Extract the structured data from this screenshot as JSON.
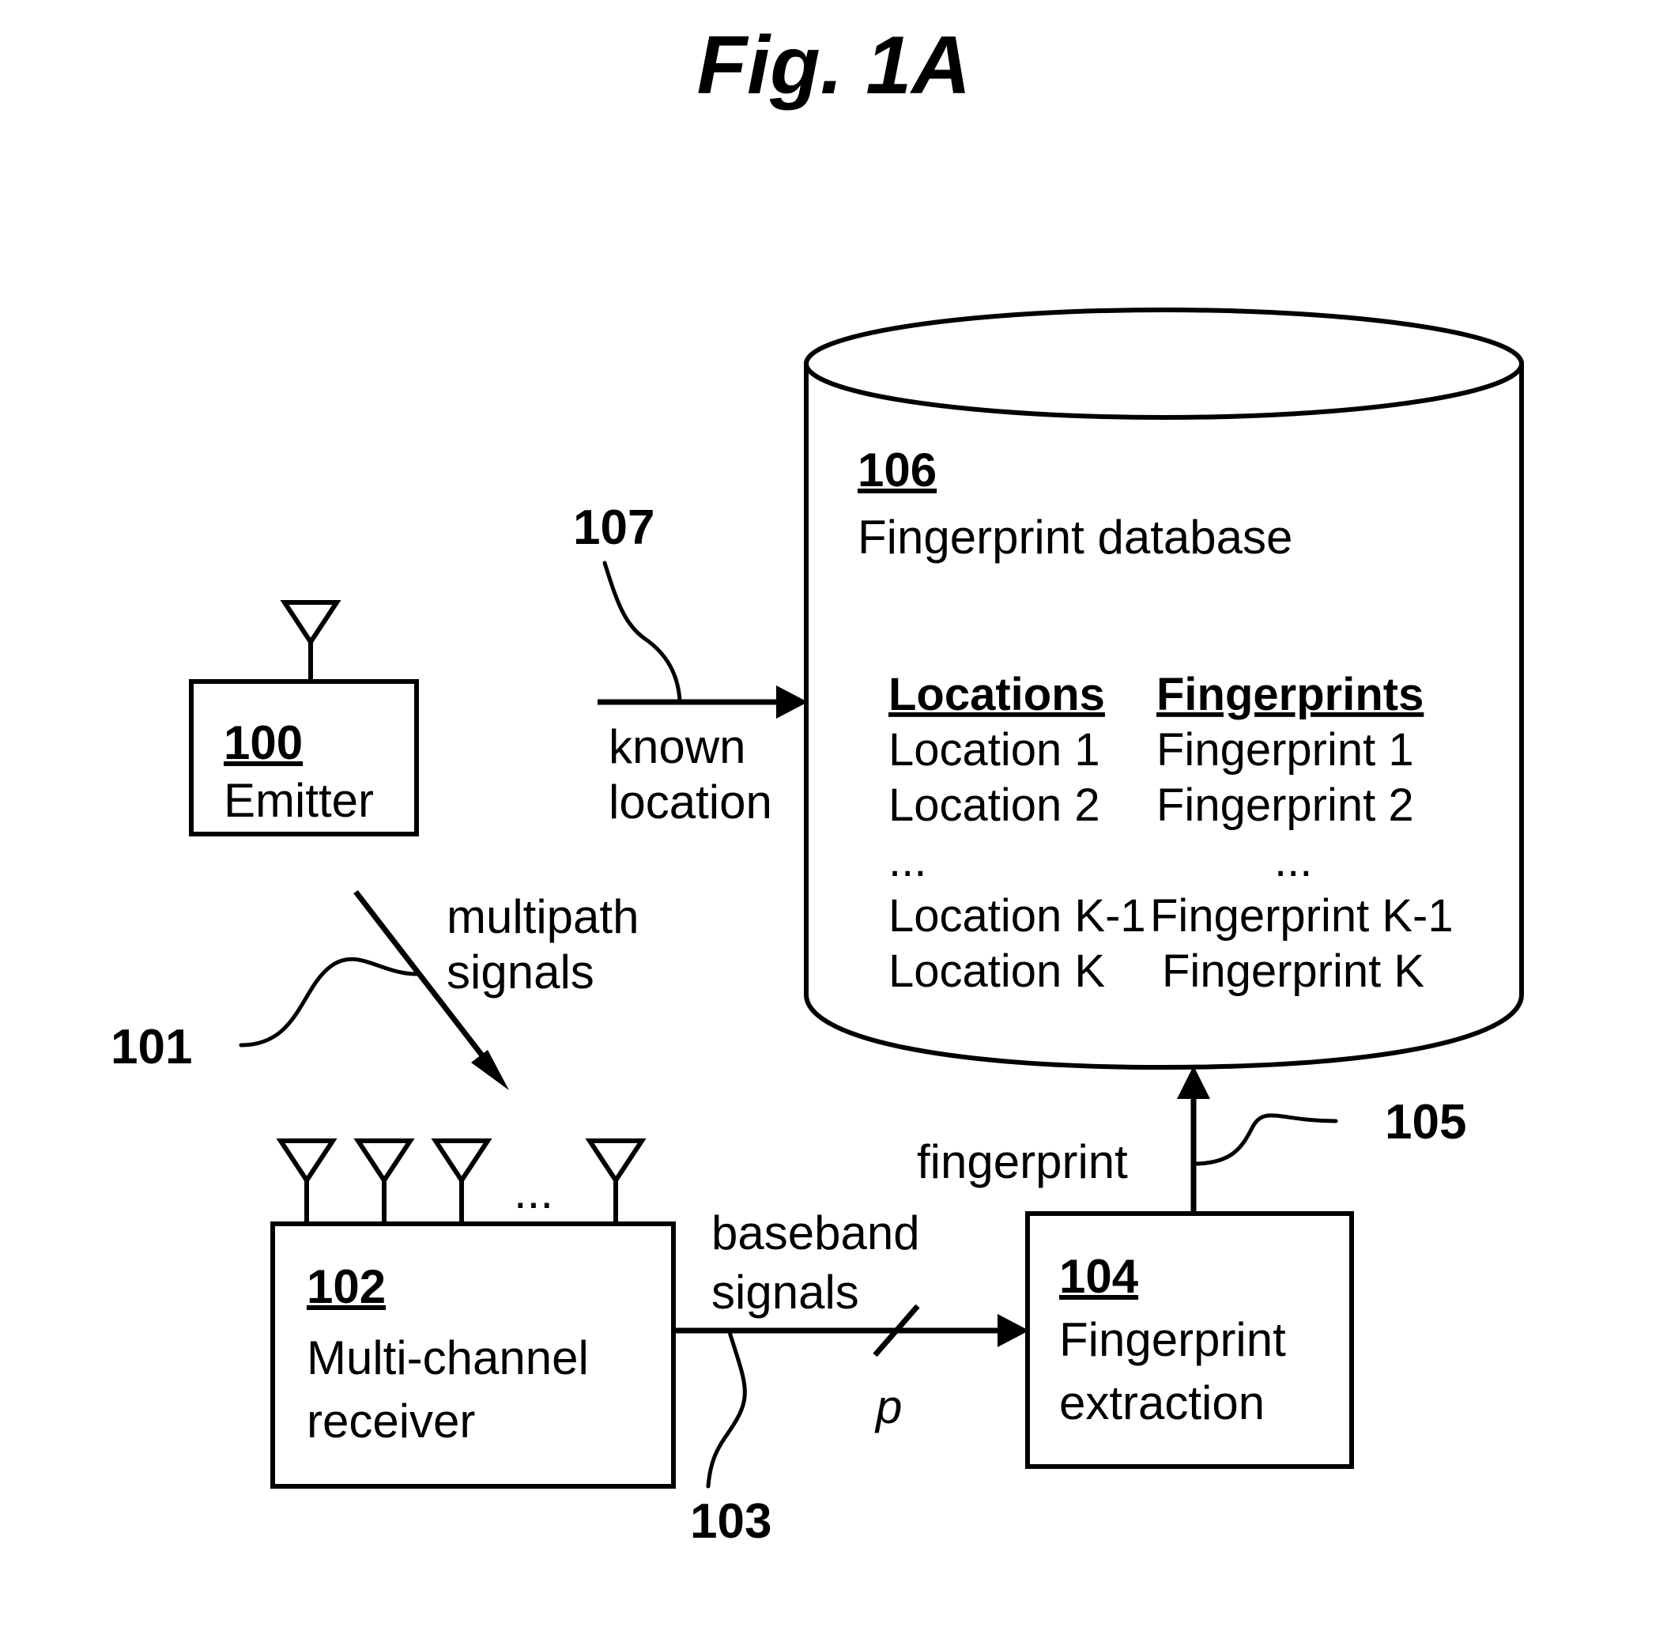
{
  "figure": {
    "title": "Fig. 1A",
    "background_color": "#ffffff",
    "line_color": "#000000"
  },
  "blocks": {
    "emitter": {
      "ref": "100",
      "label": "Emitter",
      "icon": "antenna-icon"
    },
    "receiver": {
      "ref": "102",
      "label_line1": "Multi-channel",
      "label_line2": "receiver",
      "antenna_ellipsis": "...",
      "icon": "antenna-array-icon"
    },
    "extraction": {
      "ref": "104",
      "label_line1": "Fingerprint",
      "label_line2": "extraction"
    },
    "database": {
      "ref": "106",
      "label": "Fingerprint database",
      "icon": "cylinder-database-icon"
    }
  },
  "signals": {
    "multipath": {
      "ref": "101",
      "label_line1": "multipath",
      "label_line2": "signals"
    },
    "baseband": {
      "ref": "103",
      "label_line1": "baseband",
      "label_line2": "signals",
      "bus_width": "p"
    },
    "fingerprint": {
      "ref": "105",
      "label": "fingerprint"
    },
    "known_location": {
      "ref": "107",
      "label_line1": "known",
      "label_line2": "location"
    }
  },
  "table": {
    "headers": [
      "Locations",
      "Fingerprints"
    ],
    "rows": [
      [
        "Location 1",
        "Fingerprint 1"
      ],
      [
        "Location 2",
        "Fingerprint 2"
      ],
      [
        "...",
        "..."
      ],
      [
        "Location K-1",
        "Fingerprint K-1"
      ],
      [
        "Location K",
        "Fingerprint K"
      ]
    ]
  }
}
